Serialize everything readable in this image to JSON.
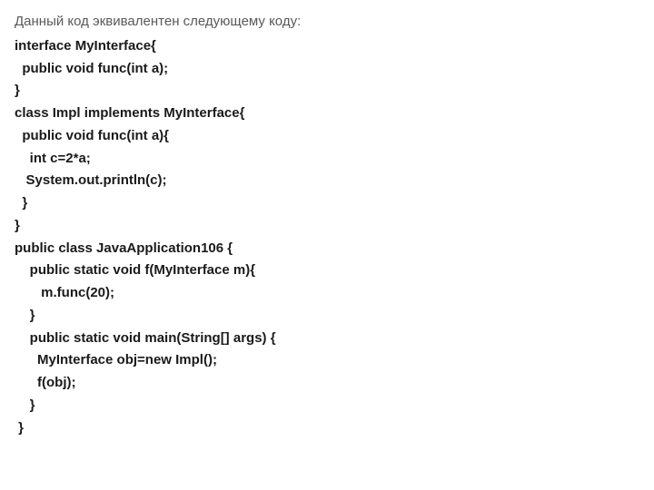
{
  "intro": "Данный код эквивалентен следующему коду:",
  "lines": [
    "interface MyInterface{",
    "  public void func(int a);",
    "}",
    "class Impl implements MyInterface{",
    "  public void func(int a){",
    "    int c=2*a;",
    "   System.out.println(c);",
    "  }",
    "}",
    "public class JavaApplication106 {",
    "    public static void f(MyInterface m){",
    "       m.func(20);",
    "    }",
    "    public static void main(String[] args) {",
    "      MyInterface obj=new Impl();",
    "      f(obj);",
    "    }",
    " }"
  ]
}
